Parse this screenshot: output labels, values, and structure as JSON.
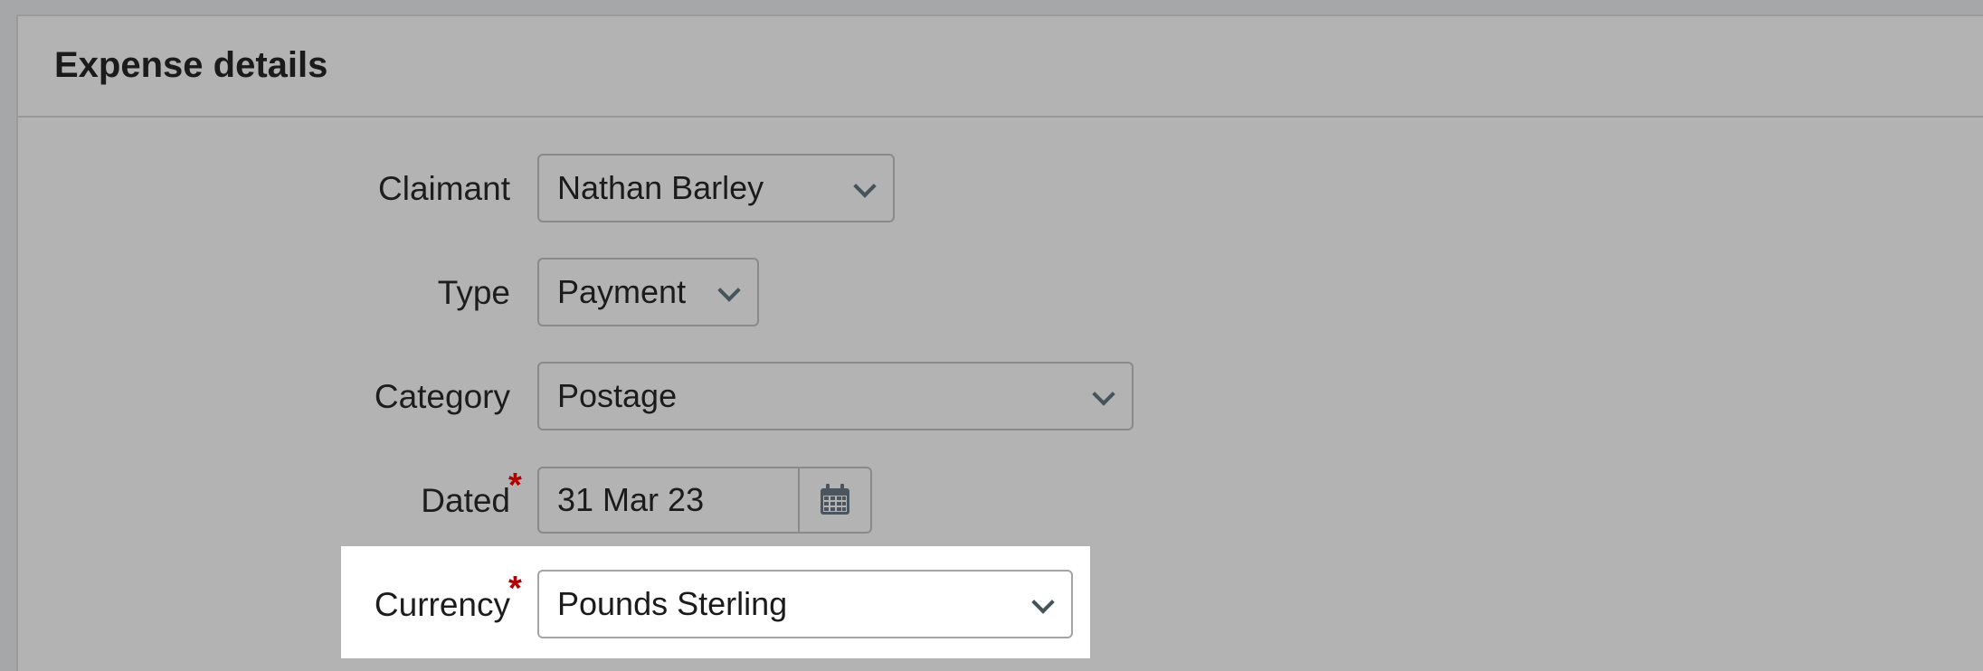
{
  "panel": {
    "title": "Expense details"
  },
  "fields": {
    "claimant": {
      "label": "Claimant",
      "value": "Nathan Barley"
    },
    "type": {
      "label": "Type",
      "value": "Payment"
    },
    "category": {
      "label": "Category",
      "value": "Postage"
    },
    "dated": {
      "label": "Dated",
      "value": "31 Mar 23",
      "required_marker": "*"
    },
    "currency": {
      "label": "Currency",
      "value": "Pounds Sterling",
      "required_marker": "*"
    }
  },
  "icons": {
    "dropdown": "chevron-down-icon",
    "date_picker": "calendar-icon"
  },
  "colors": {
    "required": "#b00000",
    "overlay": "#b3b3b3",
    "highlight": "#ffffff"
  }
}
